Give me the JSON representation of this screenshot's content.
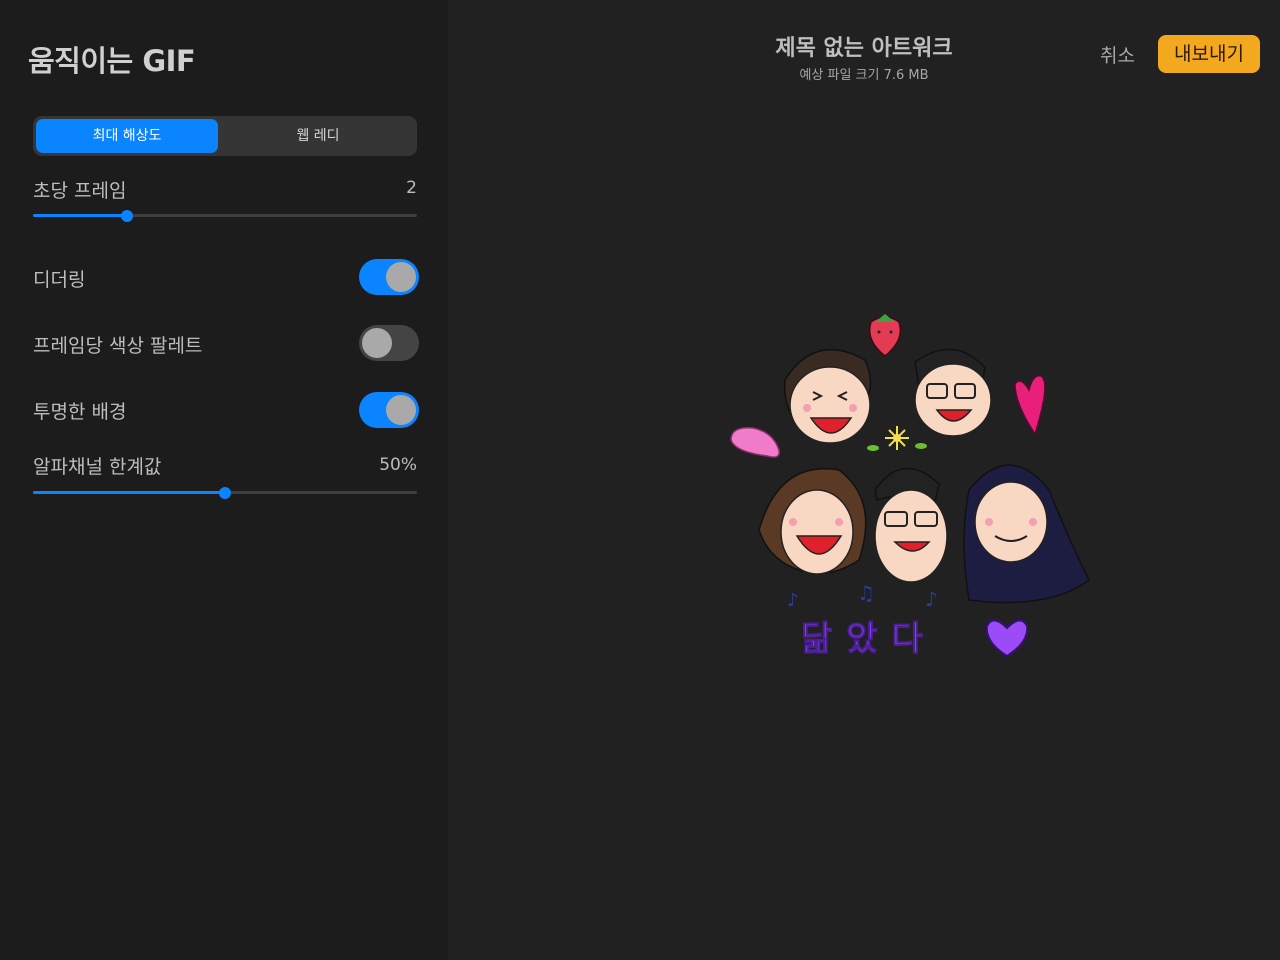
{
  "sidebar": {
    "title": "움직이는 GIF",
    "resolution": {
      "options": [
        "최대 해상도",
        "웹 레디"
      ],
      "selected": "최대 해상도"
    },
    "fps": {
      "label": "초당 프레임",
      "value": "2",
      "fraction": 0.245
    },
    "dithering": {
      "label": "디더링",
      "on": true
    },
    "per_frame_palette": {
      "label": "프레임당 색상 팔레트",
      "on": false
    },
    "transparent_bg": {
      "label": "투명한 배경",
      "on": true
    },
    "alpha_threshold": {
      "label": "알파채널 한계값",
      "value": "50%",
      "fraction": 0.5
    }
  },
  "header": {
    "title": "제목 없는 아트워크",
    "subtitle": "예상 파일 크기 7.6 MB",
    "cancel_label": "취소",
    "export_label": "내보내기"
  },
  "artwork": {
    "caption": "닮았다",
    "accent_color": "#0b84ff",
    "export_color": "#f4a81d"
  }
}
